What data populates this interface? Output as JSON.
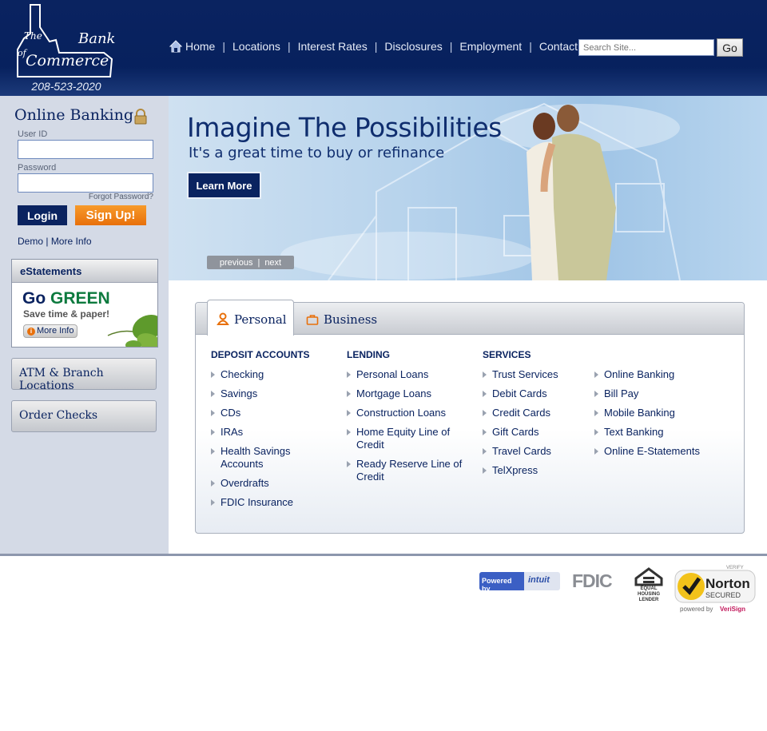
{
  "header": {
    "logo": {
      "line1": "The",
      "line2": "Bank",
      "line3": "of",
      "line4": "Commerce"
    },
    "phone": "208-523-2020",
    "nav": [
      "Home",
      "Locations",
      "Interest Rates",
      "Disclosures",
      "Employment",
      "Contact Us"
    ],
    "search": {
      "placeholder": "Search Site...",
      "go_label": "Go"
    }
  },
  "sidebar": {
    "online_banking_title": "Online Banking",
    "user_id_label": "User ID",
    "password_label": "Password",
    "forgot_password": "Forgot Password?",
    "login_label": "Login",
    "signup_label": "Sign Up!",
    "demo_link": "Demo",
    "more_info_link": "More Info",
    "estatements": {
      "title": "eStatements",
      "go": "Go",
      "green": "GREEN",
      "tagline": "Save time & paper!",
      "more_info": "More Info"
    },
    "atm_button": "ATM & Branch Locations",
    "order_checks_button": "Order Checks"
  },
  "banner": {
    "title": "Imagine The Possibilities",
    "subtitle": "It's a great time to buy or refinance",
    "cta": "Learn More",
    "prev": "previous",
    "next": "next"
  },
  "tabs": {
    "personal": "Personal",
    "business": "Business"
  },
  "columns": [
    {
      "heading": "DEPOSIT ACCOUNTS",
      "items": [
        "Checking",
        "Savings",
        "CDs",
        "IRAs",
        "Health Savings Accounts",
        "Overdrafts",
        "FDIC Insurance"
      ]
    },
    {
      "heading": "LENDING",
      "items": [
        "Personal Loans",
        "Mortgage Loans",
        "Construction Loans",
        "Home Equity Line of Credit",
        "Ready Reserve Line of Credit"
      ]
    },
    {
      "heading": "SERVICES",
      "items": [
        "Trust Services",
        "Debit Cards",
        "Credit Cards",
        "Gift Cards",
        "Travel Cards",
        "TelXpress"
      ]
    },
    {
      "heading": "",
      "items": [
        "Online Banking",
        "Bill Pay",
        "Mobile Banking",
        "Text Banking",
        "Online E-Statements"
      ]
    }
  ],
  "footer": {
    "intuit_powered": "Powered by",
    "intuit_brand": "intuit",
    "fdic": "FDIC",
    "ehl": "EQUAL HOUSING LENDER",
    "norton_verify": "VERIFY",
    "norton_name": "Norton",
    "norton_secured": "SECURED",
    "norton_powered": "powered by",
    "norton_verisign": "VeriSign"
  },
  "colors": {
    "navy": "#0a2360",
    "orange": "#e8700b",
    "green": "#0d7a3e"
  }
}
